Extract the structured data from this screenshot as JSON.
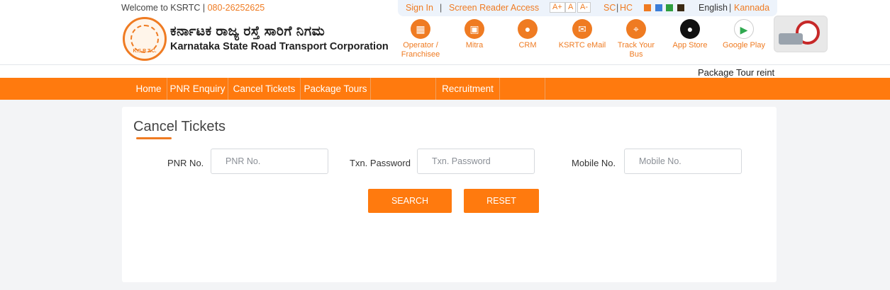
{
  "header": {
    "welcome_text": "Welcome to KSRTC |",
    "phone": "080-26252625",
    "logo_text": "K.S.R.T.C.",
    "org_name_kn": "ಕರ್ನಾಟಕ ರಾಜ್ಯ ರಸ್ತೆ ಸಾರಿಗೆ ನಿಗಮ",
    "org_name_en": "Karnataka State Road Transport Corporation"
  },
  "utility": {
    "sign_in": "Sign In",
    "separator": "|",
    "screen_reader": "Screen Reader Access",
    "font_increase": "A+",
    "font_normal": "A",
    "font_decrease": "A-",
    "sc": "SC",
    "hc": "HC",
    "english": "English",
    "kannada": "Kannada",
    "swatch_colors": [
      "#ef7b22",
      "#3b7dd8",
      "#2e9e3e",
      "#3b2a14"
    ]
  },
  "quick_links": [
    {
      "label": "Operator / Franchisee",
      "icon": "building-icon"
    },
    {
      "label": "Mitra",
      "icon": "bus-icon"
    },
    {
      "label": "CRM",
      "icon": "user-icon"
    },
    {
      "label": "KSRTC eMail",
      "icon": "mail-icon"
    },
    {
      "label": "Track Your Bus",
      "icon": "location-icon"
    },
    {
      "label": "App Store",
      "icon": "apple-icon"
    },
    {
      "label": "Google Play",
      "icon": "play-icon"
    }
  ],
  "ticker": {
    "text": "Package Tour reint"
  },
  "nav": {
    "home": "Home",
    "pnr_enquiry": "PNR Enquiry",
    "cancel_tickets": "Cancel Tickets",
    "package_tours": "Package Tours",
    "recruitment": "Recruitment"
  },
  "form": {
    "title": "Cancel Tickets",
    "pnr_label": "PNR No.",
    "pnr_placeholder": "PNR No.",
    "txn_label": "Txn. Password",
    "txn_placeholder": "Txn. Password",
    "mobile_label": "Mobile No.",
    "mobile_placeholder": "Mobile No.",
    "search_button": "SEARCH",
    "reset_button": "RESET"
  },
  "colors": {
    "accent": "#ff7a0e",
    "brand_orange": "#ef7b22"
  }
}
